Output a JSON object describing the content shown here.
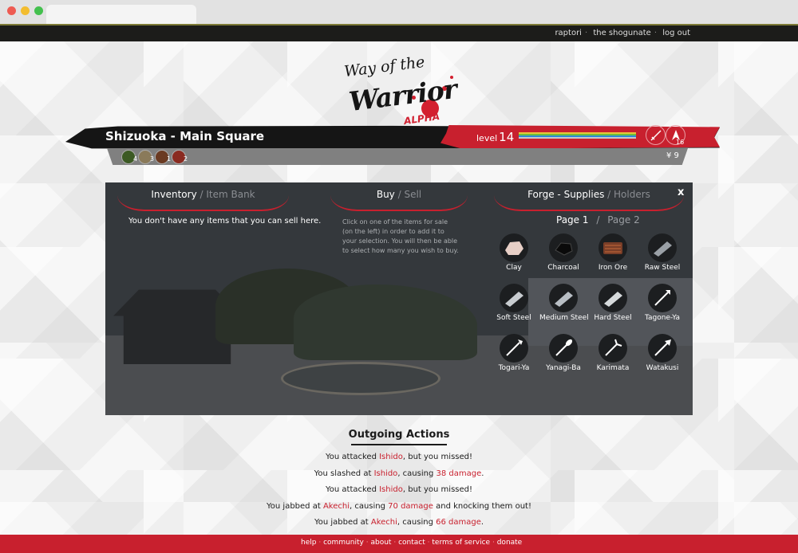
{
  "topnav": {
    "items": [
      "raptori",
      "the shogunate",
      "log out"
    ]
  },
  "logo": {
    "line1": "Way of the",
    "line2": "Warrior",
    "tag": "ALPHA"
  },
  "location": {
    "title": "Shizuoka - Main Square"
  },
  "player": {
    "level_label": "level",
    "level_value": "14",
    "arrow_count": "16",
    "money": "¥ 9"
  },
  "colors": {
    "accent": "#c8202e",
    "bar_dark": "#151515",
    "panel_bg": "#34383c",
    "health": "#2d8ad8",
    "stamina": "#6fbf3a",
    "xp": "#e7c63a"
  },
  "resources": [
    {
      "icon": "herb-icon",
      "count": "4"
    },
    {
      "icon": "mushroom-icon",
      "count": "3"
    },
    {
      "icon": "ore-icon",
      "count": "1"
    },
    {
      "icon": "berry-icon",
      "count": "2"
    }
  ],
  "panel": {
    "close": "x",
    "inventory": {
      "active": "Inventory",
      "sep": " / ",
      "inactive": "Item Bank",
      "message": "You don't have any items that you can sell here."
    },
    "trade": {
      "active": "Buy",
      "sep": " / ",
      "inactive": "Sell",
      "help": "Click on one of the items for sale (on the left) in order to add it to your selection. You will then be able to select how many you wish to buy."
    },
    "forge": {
      "active": "Forge - Supplies",
      "sep": " / ",
      "inactive": "Holders",
      "page_active": "Page 1",
      "page_sep": "/",
      "page_inactive": "Page 2",
      "items": [
        {
          "name": "Clay",
          "icon": "clay-icon"
        },
        {
          "name": "Charcoal",
          "icon": "charcoal-icon"
        },
        {
          "name": "Iron Ore",
          "icon": "iron-ore-icon"
        },
        {
          "name": "Raw Steel",
          "icon": "raw-steel-icon"
        },
        {
          "name": "Soft Steel",
          "icon": "soft-steel-icon"
        },
        {
          "name": "Medium Steel",
          "icon": "medium-steel-icon"
        },
        {
          "name": "Hard Steel",
          "icon": "hard-steel-icon"
        },
        {
          "name": "Tagone-Ya",
          "icon": "arrow-icon"
        },
        {
          "name": "Togari-Ya",
          "icon": "arrow-icon"
        },
        {
          "name": "Yanagi-Ba",
          "icon": "arrow-icon"
        },
        {
          "name": "Karimata",
          "icon": "arrow-icon"
        },
        {
          "name": "Watakusi",
          "icon": "arrow-icon"
        }
      ]
    }
  },
  "actions": {
    "title": "Outgoing Actions",
    "log": [
      {
        "a": "You attacked ",
        "target": "Ishido",
        "b": ", but you missed!",
        "dmg": "",
        "c": ""
      },
      {
        "a": "You slashed at ",
        "target": "Ishido",
        "b": ", causing ",
        "dmg": "38 damage",
        "c": "."
      },
      {
        "a": "You attacked ",
        "target": "Ishido",
        "b": ", but you missed!",
        "dmg": "",
        "c": ""
      },
      {
        "a": "You jabbed at ",
        "target": "Akechi",
        "b": ", causing ",
        "dmg": "70 damage",
        "c": " and knocking them out!"
      },
      {
        "a": "You jabbed at ",
        "target": "Akechi",
        "b": ", causing ",
        "dmg": "66 damage",
        "c": "."
      }
    ]
  },
  "footer": {
    "items": [
      "help",
      "community",
      "about",
      "contact",
      "terms of service",
      "donate"
    ]
  }
}
